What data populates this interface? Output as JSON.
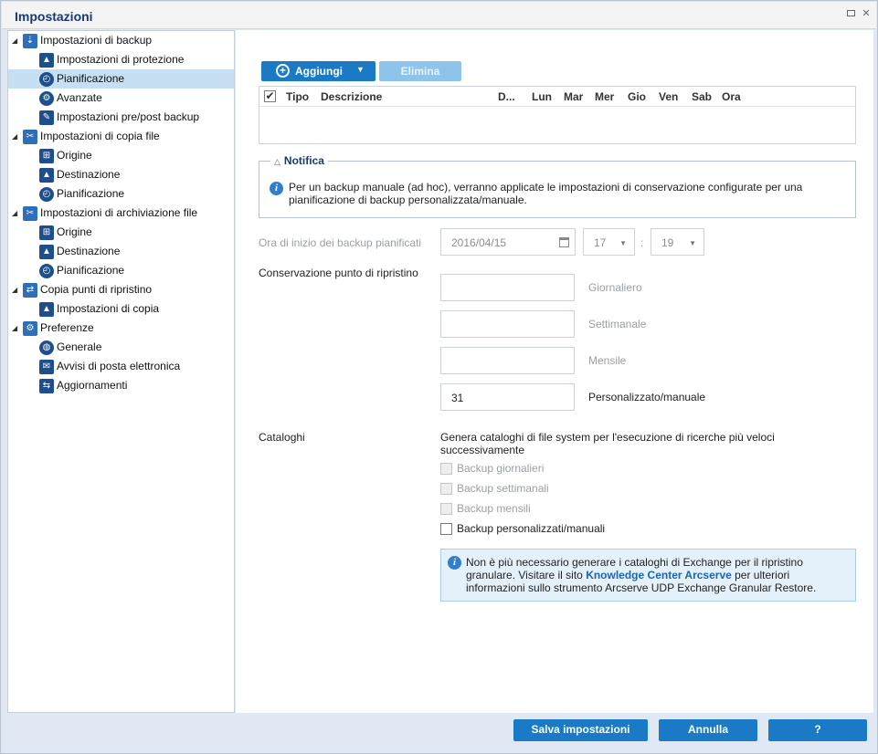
{
  "window": {
    "title": "Impostazioni"
  },
  "tree": [
    {
      "label": "Impostazioni di backup",
      "level": 0,
      "icon": "backup-settings-icon"
    },
    {
      "label": "Impostazioni di protezione",
      "level": 1,
      "icon": "protection-icon"
    },
    {
      "label": "Pianificazione",
      "level": 1,
      "icon": "schedule-icon",
      "selected": true
    },
    {
      "label": "Avanzate",
      "level": 1,
      "icon": "advanced-icon"
    },
    {
      "label": "Impostazioni pre/post backup",
      "level": 1,
      "icon": "wrench-icon"
    },
    {
      "label": "Impostazioni di copia file",
      "level": 0,
      "icon": "file-copy-icon"
    },
    {
      "label": "Origine",
      "level": 1,
      "icon": "source-icon"
    },
    {
      "label": "Destinazione",
      "level": 1,
      "icon": "destination-icon"
    },
    {
      "label": "Pianificazione",
      "level": 1,
      "icon": "schedule-icon"
    },
    {
      "label": "Impostazioni di archiviazione file",
      "level": 0,
      "icon": "file-archive-icon"
    },
    {
      "label": "Origine",
      "level": 1,
      "icon": "source-icon"
    },
    {
      "label": "Destinazione",
      "level": 1,
      "icon": "destination-icon"
    },
    {
      "label": "Pianificazione",
      "level": 1,
      "icon": "schedule-icon"
    },
    {
      "label": "Copia punti di ripristino",
      "level": 0,
      "icon": "copy-recovery-points-icon"
    },
    {
      "label": "Impostazioni di copia",
      "level": 1,
      "icon": "copy-settings-icon"
    },
    {
      "label": "Preferenze",
      "level": 0,
      "icon": "preferences-icon"
    },
    {
      "label": "Generale",
      "level": 1,
      "icon": "globe-icon"
    },
    {
      "label": "Avvisi di posta elettronica",
      "level": 1,
      "icon": "email-icon"
    },
    {
      "label": "Aggiornamenti",
      "level": 1,
      "icon": "updates-icon"
    }
  ],
  "toolbar": {
    "add_label": "Aggiungi",
    "delete_label": "Elimina"
  },
  "grid": {
    "columns": [
      "Tipo",
      "Descrizione",
      "D...",
      "Lun",
      "Mar",
      "Mer",
      "Gio",
      "Ven",
      "Sab",
      "Ora"
    ]
  },
  "notification": {
    "title": "Notifica",
    "text": "Per un backup manuale (ad hoc), verranno applicate le impostazioni di conservazione configurate per una pianificazione di backup personalizzata/manuale."
  },
  "schedule": {
    "start_label": "Ora di inizio dei backup pianificati",
    "date": "2016/04/15",
    "hour": "17",
    "separator": ":",
    "minute": "19"
  },
  "retention": {
    "label": "Conservazione punto di ripristino",
    "daily_label": "Giornaliero",
    "weekly_label": "Settimanale",
    "monthly_label": "Mensile",
    "custom_label": "Personalizzato/manuale",
    "daily_value": "",
    "weekly_value": "",
    "monthly_value": "",
    "custom_value": "31"
  },
  "catalogs": {
    "label": "Cataloghi",
    "description": "Genera cataloghi di file system per l'esecuzione di ricerche più veloci successivamente",
    "daily": "Backup giornalieri",
    "weekly": "Backup settimanali",
    "monthly": "Backup mensili",
    "custom": "Backup personalizzati/manuali"
  },
  "exchange_info": {
    "text_before": "Non è più necessario generare i cataloghi di Exchange per il ripristino granulare. Visitare il sito ",
    "link": "Knowledge Center Arcserve",
    "text_after": " per ulteriori informazioni sullo strumento Arcserve UDP Exchange Granular Restore."
  },
  "footer": {
    "save_label": "Salva impostazioni",
    "cancel_label": "Annulla",
    "help_label": "?"
  }
}
